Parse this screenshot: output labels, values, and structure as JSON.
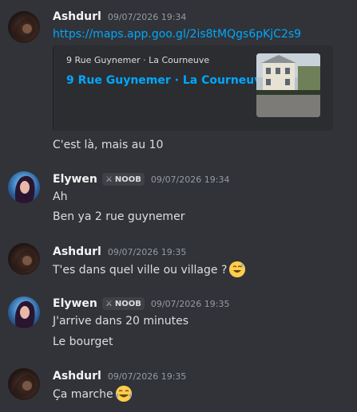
{
  "messages": [
    {
      "author": "Ashdurl",
      "timestamp": "09/07/2026 19:34",
      "link": "https://maps.app.goo.gl/2is8tMQgs6pKjC2s9",
      "embed": {
        "provider": "9 Rue Guynemer · La Courneuve",
        "title": "9 Rue Guynemer · La Courneuve"
      },
      "lines": [
        "C'est là, mais au 10"
      ]
    },
    {
      "author": "Elywen",
      "badge": "NOOB",
      "timestamp": "09/07/2026 19:34",
      "lines": [
        "Ah",
        "Ben ya 2 rue guynemer"
      ]
    },
    {
      "author": "Ashdurl",
      "timestamp": "09/07/2026 19:35",
      "lines": [
        "T'es dans quel ville ou village ?"
      ],
      "emoji": "sweat-smile-emoji"
    },
    {
      "author": "Elywen",
      "badge": "NOOB",
      "timestamp": "09/07/2026 19:35",
      "lines": [
        "J'arrive dans 20 minutes",
        "Le bourget"
      ]
    },
    {
      "author": "Ashdurl",
      "timestamp": "09/07/2026 19:35",
      "lines": [
        "Ça marche"
      ],
      "emoji": "joy-emoji"
    }
  ],
  "colors": {
    "background": "#313338",
    "link": "#00a8fc",
    "embed_bg": "#2b2d31",
    "timestamp": "#949ba4"
  }
}
